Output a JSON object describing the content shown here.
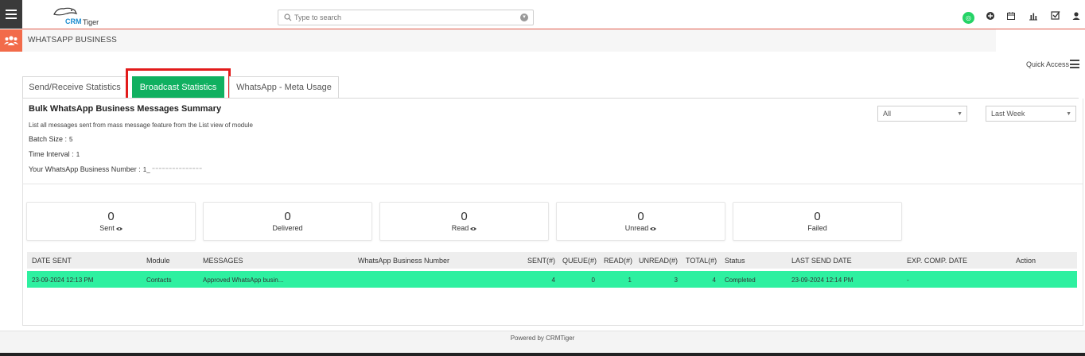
{
  "app": {
    "brand_crm": "CRM",
    "brand_tiger": "Tiger",
    "module_title": "WHATSAPP BUSINESS",
    "quick_access": "Quick Access"
  },
  "search": {
    "placeholder": "Type to search"
  },
  "tabs": [
    {
      "label": "Send/Receive Statistics",
      "active": false
    },
    {
      "label": "Broadcast Statistics",
      "active": true
    },
    {
      "label": "WhatsApp - Meta Usage",
      "active": false
    }
  ],
  "summary": {
    "title": "Bulk WhatsApp Business Messages Summary",
    "description": "List all messages sent from mass message feature from the List view of module",
    "batch_size_label": "Batch Size :",
    "batch_size_value": "5",
    "time_interval_label": "Time Interval :",
    "time_interval_value": "1",
    "number_label": "Your WhatsApp Business Number :",
    "number_value": "1_ ⁻⁻⁻⁻⁻⁻⁻⁻⁻⁻⁻⁻⁻⁻⁻"
  },
  "filters": {
    "status_selected": "All",
    "period_selected": "Last Week"
  },
  "stats": [
    {
      "value": "0",
      "label": "Sent",
      "has_eye": true
    },
    {
      "value": "0",
      "label": "Delivered",
      "has_eye": false
    },
    {
      "value": "0",
      "label": "Read",
      "has_eye": true
    },
    {
      "value": "0",
      "label": "Unread",
      "has_eye": true
    },
    {
      "value": "0",
      "label": "Failed",
      "has_eye": false
    }
  ],
  "table": {
    "headers": {
      "date_sent": "DATE SENT",
      "module": "Module",
      "messages": "MESSAGES",
      "number": "WhatsApp Business Number",
      "sent": "SENT(#)",
      "queue": "QUEUE(#)",
      "read": "READ(#)",
      "unread": "UNREAD(#)",
      "total": "TOTAL(#)",
      "status": "Status",
      "last_send": "LAST SEND DATE",
      "exp": "EXP. COMP. DATE",
      "action": "Action"
    },
    "rows": [
      {
        "date_sent": "23-09-2024 12:13 PM",
        "module": "Contacts",
        "messages": "Approved WhatsApp busin...",
        "number": "",
        "sent": "4",
        "queue": "0",
        "read": "1",
        "unread": "3",
        "total": "4",
        "status": "Completed",
        "last_send": "23-09-2024 12:14 PM",
        "exp": "-",
        "action": ""
      }
    ]
  },
  "footer": {
    "text": "Powered by CRMTiger"
  },
  "colors": {
    "active_tab": "#10b060",
    "highlight_outline": "#e21b1b",
    "row_highlight": "#2ef0a0",
    "module_icon": "#f26b4a",
    "whatsapp": "#25d366"
  },
  "icons": {
    "topbar": [
      "whatsapp-icon",
      "add-icon",
      "calendar-icon",
      "chart-icon",
      "tasks-icon",
      "user-icon"
    ],
    "eye": "eye-icon"
  }
}
